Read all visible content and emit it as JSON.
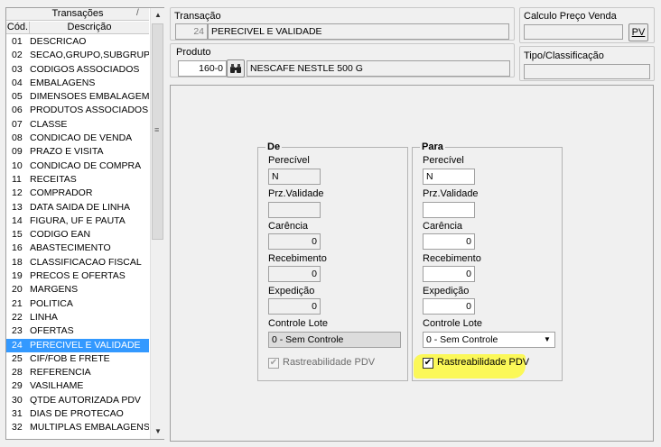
{
  "list": {
    "title": "Transações",
    "slash": "/",
    "col_cod": "Cód.",
    "col_desc": "Descrição",
    "rows": [
      {
        "cod": "01",
        "desc": "DESCRICAO"
      },
      {
        "cod": "02",
        "desc": "SECAO,GRUPO,SUBGRUPO"
      },
      {
        "cod": "03",
        "desc": "CODIGOS ASSOCIADOS"
      },
      {
        "cod": "04",
        "desc": "EMBALAGENS"
      },
      {
        "cod": "05",
        "desc": "DIMENSOES EMBALAGEM"
      },
      {
        "cod": "06",
        "desc": "PRODUTOS ASSOCIADOS"
      },
      {
        "cod": "07",
        "desc": "CLASSE"
      },
      {
        "cod": "08",
        "desc": "CONDICAO DE VENDA"
      },
      {
        "cod": "09",
        "desc": "PRAZO E VISITA"
      },
      {
        "cod": "10",
        "desc": "CONDICAO DE COMPRA"
      },
      {
        "cod": "11",
        "desc": "RECEITAS"
      },
      {
        "cod": "12",
        "desc": "COMPRADOR"
      },
      {
        "cod": "13",
        "desc": "DATA SAIDA DE LINHA"
      },
      {
        "cod": "14",
        "desc": "FIGURA, UF E PAUTA"
      },
      {
        "cod": "15",
        "desc": "CODIGO EAN"
      },
      {
        "cod": "16",
        "desc": "ABASTECIMENTO"
      },
      {
        "cod": "18",
        "desc": "CLASSIFICACAO FISCAL"
      },
      {
        "cod": "19",
        "desc": "PRECOS E OFERTAS"
      },
      {
        "cod": "20",
        "desc": "MARGENS"
      },
      {
        "cod": "21",
        "desc": "POLITICA"
      },
      {
        "cod": "22",
        "desc": "LINHA"
      },
      {
        "cod": "23",
        "desc": "OFERTAS"
      },
      {
        "cod": "24",
        "desc": "PERECIVEL E VALIDADE"
      },
      {
        "cod": "25",
        "desc": "CIF/FOB E FRETE"
      },
      {
        "cod": "28",
        "desc": "REFERENCIA"
      },
      {
        "cod": "29",
        "desc": "VASILHAME"
      },
      {
        "cod": "30",
        "desc": "QTDE AUTORIZADA PDV"
      },
      {
        "cod": "31",
        "desc": "DIAS DE PROTECAO"
      },
      {
        "cod": "32",
        "desc": "MULTIPLAS EMBALAGENS"
      }
    ],
    "selected_index": 22,
    "scroll_up": "▲",
    "scroll_down": "▼",
    "scroll_grip": "≡"
  },
  "transacao": {
    "label": "Transação",
    "code": "24",
    "name": "PERECIVEL E VALIDADE"
  },
  "produto": {
    "label": "Produto",
    "code": "160-0",
    "search_icon": "binoculars-icon",
    "name": "NESCAFE NESTLE 500 G"
  },
  "calculo": {
    "label": "Calculo Preço Venda",
    "value": "",
    "pv_button": "PV"
  },
  "tipo": {
    "label": "Tipo/Classificação",
    "value": ""
  },
  "de": {
    "legend": "De",
    "perecivel_label": "Perecível",
    "perecivel_value": "N",
    "prz_validade_label": "Prz.Validade",
    "prz_validade_value": "",
    "carencia_label": "Carência",
    "carencia_value": "0",
    "recebimento_label": "Recebimento",
    "recebimento_value": "0",
    "expedicao_label": "Expedição",
    "expedicao_value": "0",
    "controle_lote_label": "Controle Lote",
    "controle_lote_value": "0 - Sem Controle",
    "rastreabilidade_label": "Rastreabilidade PDV",
    "rastreabilidade_checked": true
  },
  "para": {
    "legend": "Para",
    "perecivel_label": "Perecível",
    "perecivel_value": "N",
    "prz_validade_label": "Prz.Validade",
    "prz_validade_value": "",
    "carencia_label": "Carência",
    "carencia_value": "0",
    "recebimento_label": "Recebimento",
    "recebimento_value": "0",
    "expedicao_label": "Expedição",
    "expedicao_value": "0",
    "controle_lote_label": "Controle Lote",
    "controle_lote_value": "0 - Sem Controle",
    "rastreabilidade_label": "Rastreabilidade PDV",
    "rastreabilidade_checked": true,
    "dropdown_arrow": "▼",
    "highlight_color": "#fbf84f"
  },
  "colors": {
    "selection": "#3399ff",
    "background": "#f0f0f0"
  }
}
